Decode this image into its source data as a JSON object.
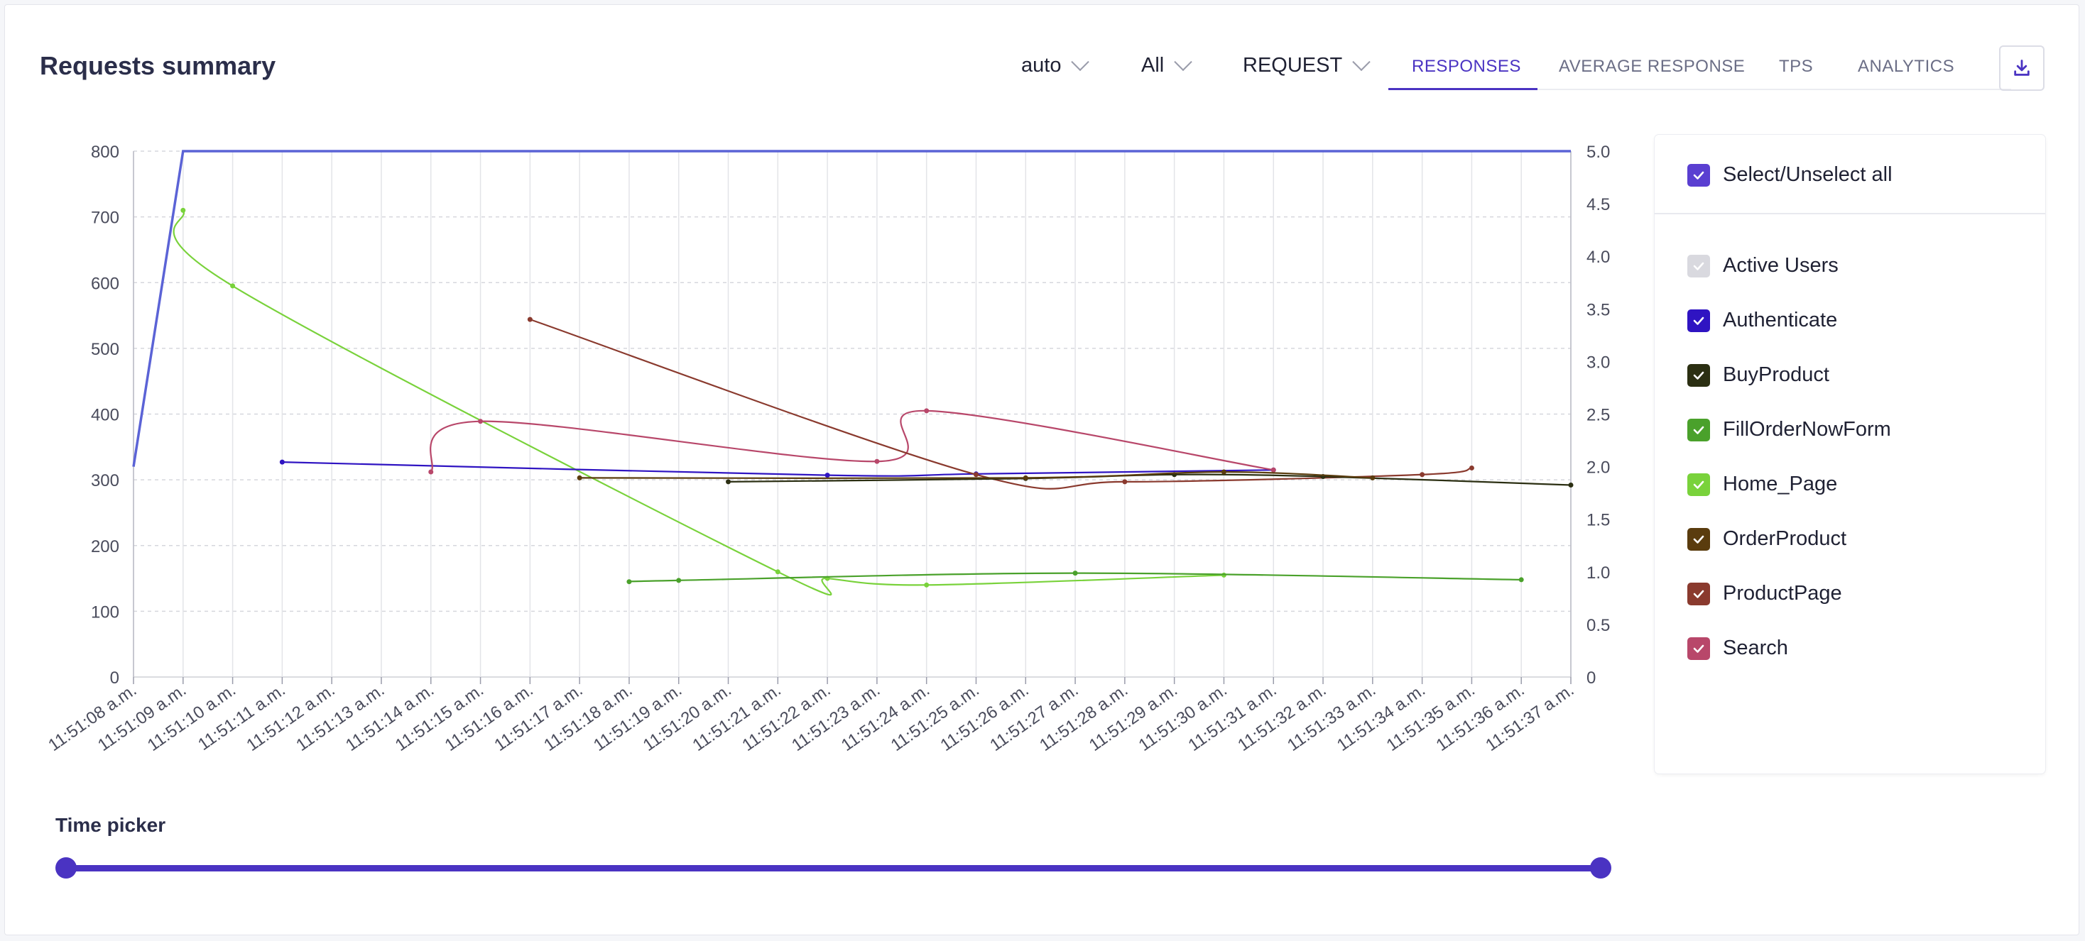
{
  "header": {
    "title": "Requests summary",
    "dropdowns": [
      {
        "name": "granularity",
        "value": "auto"
      },
      {
        "name": "filter",
        "value": "All"
      },
      {
        "name": "type",
        "value": "REQUEST"
      }
    ],
    "tabs": [
      {
        "label": "RESPONSES",
        "active": true
      },
      {
        "label": "AVERAGE RESPONSE",
        "active": false
      },
      {
        "label": "TPS",
        "active": false
      },
      {
        "label": "ANALYTICS",
        "active": false
      }
    ],
    "download_icon": "download-icon"
  },
  "legend": {
    "select_all": {
      "label": "Select/Unselect all",
      "checked": true
    },
    "items": [
      {
        "label": "Active Users",
        "color": "#d9d9df",
        "checked": true
      },
      {
        "label": "Authenticate",
        "color": "#2f14c2",
        "checked": true
      },
      {
        "label": "BuyProduct",
        "color": "#2b2f12",
        "checked": true
      },
      {
        "label": "FillOrderNowForm",
        "color": "#4aa12b",
        "checked": true
      },
      {
        "label": "Home_Page",
        "color": "#79d23b",
        "checked": true
      },
      {
        "label": "OrderProduct",
        "color": "#5a3c0e",
        "checked": true
      },
      {
        "label": "ProductPage",
        "color": "#8a3a2e",
        "checked": true
      },
      {
        "label": "Search",
        "color": "#b8476a",
        "checked": true
      }
    ]
  },
  "time_picker": {
    "label": "Time picker",
    "range": [
      0,
      1
    ]
  },
  "chart_data": {
    "type": "line",
    "x": [
      "11:51:08 a.m.",
      "11:51:09 a.m.",
      "11:51:10 a.m.",
      "11:51:11 a.m.",
      "11:51:12 a.m.",
      "11:51:13 a.m.",
      "11:51:14 a.m.",
      "11:51:15 a.m.",
      "11:51:16 a.m.",
      "11:51:17 a.m.",
      "11:51:18 a.m.",
      "11:51:19 a.m.",
      "11:51:20 a.m.",
      "11:51:21 a.m.",
      "11:51:22 a.m.",
      "11:51:23 a.m.",
      "11:51:24 a.m.",
      "11:51:25 a.m.",
      "11:51:26 a.m.",
      "11:51:27 a.m.",
      "11:51:28 a.m.",
      "11:51:29 a.m.",
      "11:51:30 a.m.",
      "11:51:31 a.m.",
      "11:51:32 a.m.",
      "11:51:33 a.m.",
      "11:51:34 a.m.",
      "11:51:35 a.m.",
      "11:51:36 a.m.",
      "11:51:37 a.m."
    ],
    "y_left": {
      "ticks": [
        "0",
        "100",
        "200",
        "300",
        "400",
        "500",
        "600",
        "700",
        "800"
      ],
      "ylim": [
        0,
        800
      ]
    },
    "y_right": {
      "ticks": [
        "0",
        "0.5",
        "1.0",
        "1.5",
        "2.0",
        "2.5",
        "3.0",
        "3.5",
        "4.0",
        "4.5",
        "5.0"
      ],
      "ylim": [
        0,
        5
      ]
    },
    "grid": true,
    "series": [
      {
        "name": "Active Users",
        "color": "#5b63d6",
        "axis": "right",
        "dots": false,
        "points": [
          [
            0,
            2.0
          ],
          [
            1,
            5.0
          ],
          [
            29,
            5.0
          ]
        ]
      },
      {
        "name": "Home_Page",
        "color": "#79d23b",
        "axis": "left",
        "dots": true,
        "points": [
          [
            1,
            710
          ],
          [
            2,
            595
          ],
          [
            13,
            160
          ],
          [
            14,
            150
          ],
          [
            16,
            140
          ],
          [
            22,
            155
          ]
        ]
      },
      {
        "name": "FillOrderNowForm",
        "color": "#4aa12b",
        "axis": "left",
        "dots": true,
        "points": [
          [
            10,
            145
          ],
          [
            11,
            147
          ],
          [
            19,
            158
          ],
          [
            28,
            148
          ]
        ]
      },
      {
        "name": "Authenticate",
        "color": "#2f14c2",
        "axis": "left",
        "dots": true,
        "points": [
          [
            3,
            327
          ],
          [
            14,
            307
          ],
          [
            17,
            309
          ],
          [
            23,
            315
          ]
        ]
      },
      {
        "name": "Search",
        "color": "#b8476a",
        "axis": "left",
        "dots": true,
        "points": [
          [
            6,
            312
          ],
          [
            7,
            389
          ],
          [
            15,
            328
          ],
          [
            16,
            405
          ],
          [
            23,
            315
          ]
        ]
      },
      {
        "name": "ProductPage",
        "color": "#8a3a2e",
        "axis": "left",
        "dots": true,
        "points": [
          [
            8,
            544
          ],
          [
            17,
            308
          ],
          [
            20,
            297
          ],
          [
            26,
            308
          ],
          [
            27,
            318
          ]
        ]
      },
      {
        "name": "BuyProduct",
        "color": "#2b2f12",
        "axis": "left",
        "dots": true,
        "points": [
          [
            12,
            297
          ],
          [
            18,
            302
          ],
          [
            21,
            308
          ],
          [
            24,
            305
          ],
          [
            29,
            292
          ]
        ]
      },
      {
        "name": "OrderProduct",
        "color": "#5a3c0e",
        "axis": "left",
        "dots": true,
        "points": [
          [
            9,
            303
          ],
          [
            18,
            303
          ],
          [
            22,
            312
          ],
          [
            25,
            303
          ]
        ]
      }
    ]
  }
}
